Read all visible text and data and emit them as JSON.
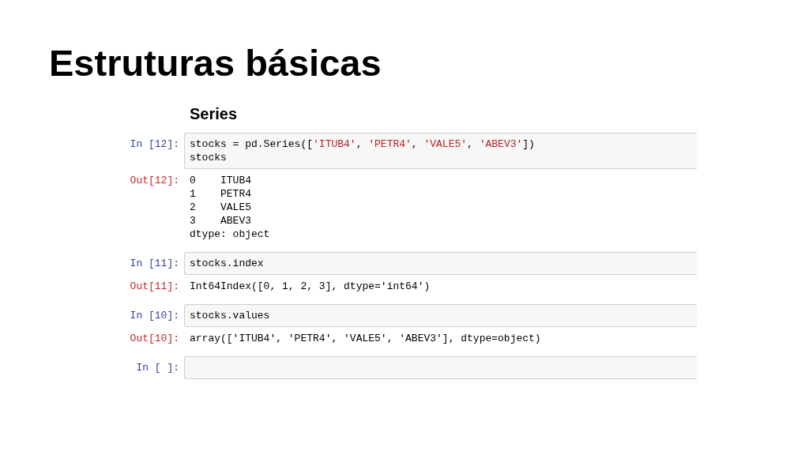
{
  "title": "Estruturas básicas",
  "notebook": {
    "heading": "Series",
    "cells": [
      {
        "prompt": "In [12]:",
        "code": [
          [
            {
              "kind": "plain",
              "text": "stocks = pd.Series(["
            },
            {
              "kind": "string",
              "text": "'ITUB4'"
            },
            {
              "kind": "plain",
              "text": ", "
            },
            {
              "kind": "string",
              "text": "'PETR4'"
            },
            {
              "kind": "plain",
              "text": ", "
            },
            {
              "kind": "string",
              "text": "'VALE5'"
            },
            {
              "kind": "plain",
              "text": ", "
            },
            {
              "kind": "string",
              "text": "'ABEV3'"
            },
            {
              "kind": "plain",
              "text": "])"
            }
          ],
          [
            {
              "kind": "plain",
              "text": "stocks"
            }
          ]
        ],
        "output_prompt": "Out[12]:",
        "output": [
          "0    ITUB4",
          "1    PETR4",
          "2    VALE5",
          "3    ABEV3",
          "dtype: object"
        ]
      },
      {
        "prompt": "In [11]:",
        "code": [
          [
            {
              "kind": "plain",
              "text": "stocks.index"
            }
          ]
        ],
        "output_prompt": "Out[11]:",
        "output": [
          "Int64Index([0, 1, 2, 3], dtype='int64')"
        ]
      },
      {
        "prompt": "In [10]:",
        "code": [
          [
            {
              "kind": "plain",
              "text": "stocks.values"
            }
          ]
        ],
        "output_prompt": "Out[10]:",
        "output": [
          "array(['ITUB4', 'PETR4', 'VALE5', 'ABEV3'], dtype=object)"
        ]
      },
      {
        "prompt": "In [ ]:"
      }
    ]
  }
}
